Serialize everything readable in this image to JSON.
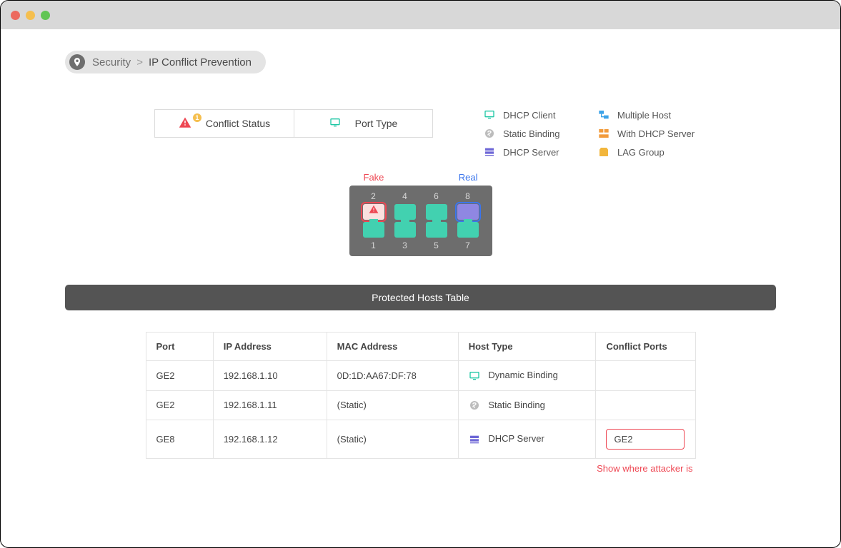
{
  "breadcrumb": {
    "parent": "Security",
    "current": "IP Conflict Prevention"
  },
  "tabs": {
    "conflict_status": "Conflict Status",
    "port_type": "Port Type",
    "conflict_badge": "1"
  },
  "legend": {
    "dhcp_client": "DHCP Client",
    "multiple_host": "Multiple Host",
    "static_binding": "Static Binding",
    "with_dhcp_server": "With DHCP Server",
    "dhcp_server": "DHCP Server",
    "lag_group": "LAG Group"
  },
  "switch": {
    "fake_label": "Fake",
    "real_label": "Real",
    "top_numbers": [
      "2",
      "4",
      "6",
      "8"
    ],
    "bottom_numbers": [
      "1",
      "3",
      "5",
      "7"
    ]
  },
  "table": {
    "title": "Protected Hosts Table",
    "headers": {
      "port": "Port",
      "ip": "IP Address",
      "mac": "MAC Address",
      "host_type": "Host Type",
      "conflict": "Conflict Ports"
    },
    "rows": [
      {
        "port": "GE2",
        "ip": "192.168.1.10",
        "mac": "0D:1D:AA67:DF:78",
        "host_type": "Dynamic Binding",
        "host_type_icon": "dhcp_client",
        "conflict": ""
      },
      {
        "port": "GE2",
        "ip": "192.168.1.11",
        "mac": "(Static)",
        "host_type": "Static Binding",
        "host_type_icon": "static_binding",
        "conflict": ""
      },
      {
        "port": "GE8",
        "ip": "192.168.1.12",
        "mac": "(Static)",
        "host_type": "DHCP Server",
        "host_type_icon": "dhcp_server",
        "conflict": "GE2"
      }
    ],
    "attacker_note": "Show where attacker is"
  }
}
